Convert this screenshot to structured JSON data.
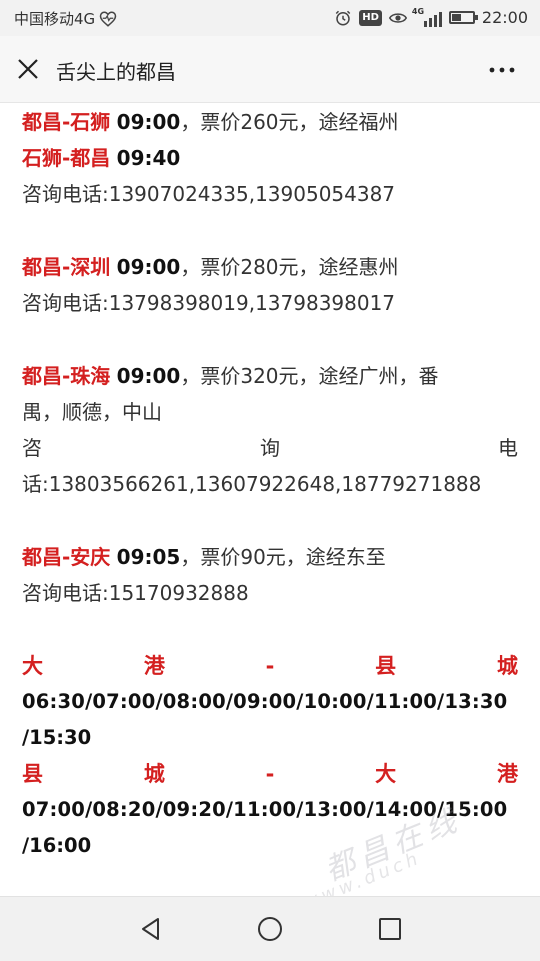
{
  "status_bar": {
    "carrier": "中国移动4G",
    "hd_badge": "HD",
    "signal_label": "4G",
    "battery_level": 0.4,
    "time": "22:00",
    "icons": [
      "heart-pulse-icon",
      "alarm-icon",
      "hd-icon",
      "eye-icon",
      "signal-icon",
      "battery-icon"
    ]
  },
  "header": {
    "close_icon": "close-icon",
    "title": "舌尖上的都昌",
    "more_icon": "more-icon"
  },
  "sections": {
    "s1": {
      "route1": "都昌-石狮",
      "time1": "09:00",
      "info1": "，票价260元，途经福州",
      "route2": "石狮-都昌",
      "time2": "09:40",
      "phone": "咨询电话:13907024335,13905054387"
    },
    "s2": {
      "route": "都昌-深圳",
      "time": "09:00",
      "info": "，票价280元，途经惠州",
      "phone": "咨询电话:13798398019,13798398017"
    },
    "s3": {
      "route": "都昌-珠海",
      "time": "09:00",
      "info_a": "，票价320元，途经广州，番",
      "info_b": "禺，顺德，中山",
      "phone_chars": [
        "咨",
        "询",
        "电"
      ],
      "phone_b": "话:13803566261,13607922648,18779271888"
    },
    "s4": {
      "route": "都昌-安庆",
      "time": "09:05",
      "info": "，票价90元，途经东至",
      "phone": "咨询电话:15170932888"
    },
    "s5": {
      "route_chars": [
        "大",
        "港",
        "-",
        "县",
        "城"
      ],
      "times_a": "06:30/07:00/08:00/09:00/10:00/11:00/13:30",
      "times_b": "/15:30"
    },
    "s6": {
      "route_chars": [
        "县",
        "城",
        "-",
        "大",
        "港"
      ],
      "times_a": "07:00/08:20/09:20/11:00/13:00/14:00/15:00",
      "times_b": "/16:00"
    }
  },
  "watermark": {
    "text": "都昌在线",
    "sub": "www.duch"
  },
  "navbar": {
    "icons": [
      "back-triangle-icon",
      "home-circle-icon",
      "recent-square-icon"
    ]
  },
  "colors": {
    "route_red": "#d42020",
    "text": "#333333",
    "statusbar_bg": "#f2f2f2",
    "navbar_bg": "#f1f1f1"
  }
}
